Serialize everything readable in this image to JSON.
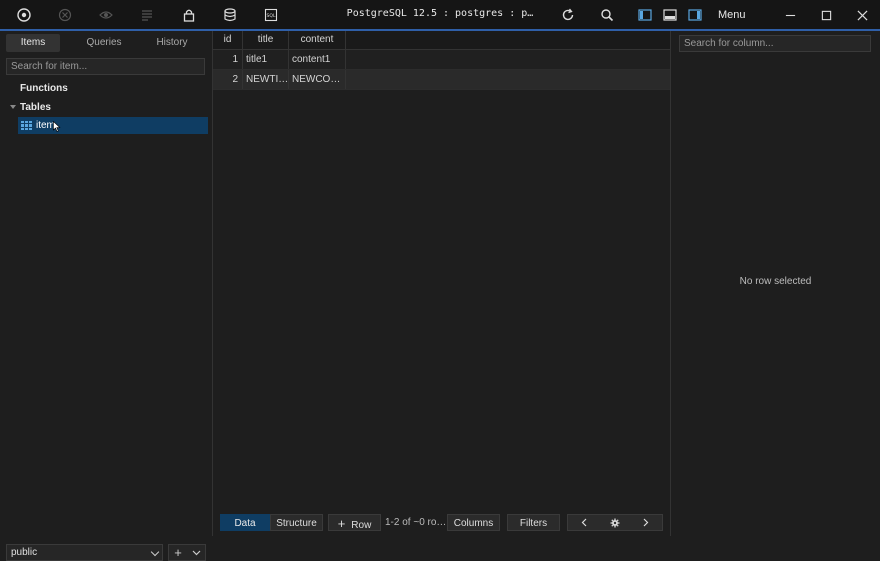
{
  "window": {
    "title": "PostgreSQL 12.5 : postgres : p…",
    "menu_label": "Menu"
  },
  "sidebar": {
    "tabs": [
      "Items",
      "Queries",
      "History"
    ],
    "search_placeholder": "Search for item...",
    "functions_label": "Functions",
    "tables_label": "Tables",
    "table_items": [
      "item"
    ],
    "schema_value": "public"
  },
  "grid": {
    "columns": [
      "id",
      "title",
      "content"
    ],
    "rows": [
      [
        "1",
        "title1",
        "content1"
      ],
      [
        "2",
        "NEWTI…",
        "NEWCO…"
      ]
    ]
  },
  "footer": {
    "data_label": "Data",
    "structure_label": "Structure",
    "add_row_label": "Row",
    "row_count": "1-2 of ~0 ro…",
    "columns_label": "Columns",
    "filters_label": "Filters"
  },
  "detail": {
    "search_placeholder": "Search for column...",
    "empty_message": "No row selected"
  },
  "colors": {
    "accent": "#2f5fa8",
    "selection": "#0f3d63"
  }
}
